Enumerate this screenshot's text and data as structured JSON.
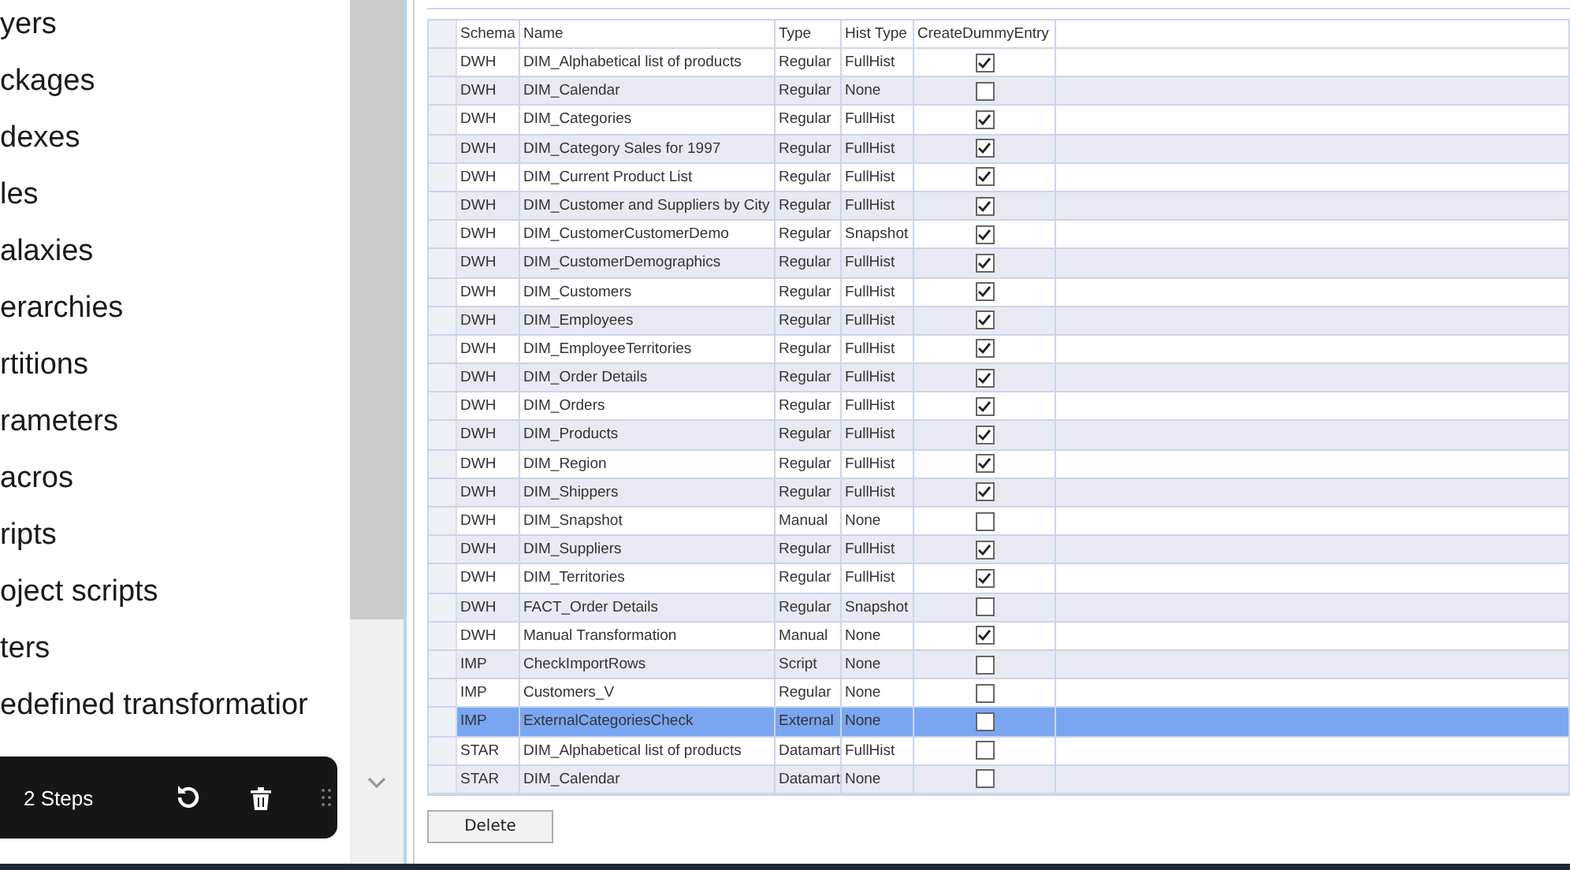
{
  "sidebar": {
    "items": [
      {
        "label": "yers"
      },
      {
        "label": "ckages"
      },
      {
        "label": "dexes"
      },
      {
        "label": "les"
      },
      {
        "label": "alaxies"
      },
      {
        "label": "erarchies"
      },
      {
        "label": "rtitions"
      },
      {
        "label": "rameters"
      },
      {
        "label": "acros"
      },
      {
        "label": "ripts"
      },
      {
        "label": "oject scripts"
      },
      {
        "label": "ters"
      },
      {
        "label": "edefined transformatior"
      }
    ]
  },
  "steps_toolbar": {
    "label": "2 Steps"
  },
  "table": {
    "columns": [
      "Schema",
      "Name",
      "Type",
      "Hist Type",
      "CreateDummyEntry"
    ],
    "rows": [
      {
        "schema": "DWH",
        "name": "DIM_Alphabetical list of products",
        "type": "Regular",
        "hist_type": "FullHist",
        "create_dummy_entry": true,
        "selected": false
      },
      {
        "schema": "DWH",
        "name": "DIM_Calendar",
        "type": "Regular",
        "hist_type": "None",
        "create_dummy_entry": false,
        "selected": false
      },
      {
        "schema": "DWH",
        "name": "DIM_Categories",
        "type": "Regular",
        "hist_type": "FullHist",
        "create_dummy_entry": true,
        "selected": false
      },
      {
        "schema": "DWH",
        "name": "DIM_Category Sales for 1997",
        "type": "Regular",
        "hist_type": "FullHist",
        "create_dummy_entry": true,
        "selected": false
      },
      {
        "schema": "DWH",
        "name": "DIM_Current Product List",
        "type": "Regular",
        "hist_type": "FullHist",
        "create_dummy_entry": true,
        "selected": false
      },
      {
        "schema": "DWH",
        "name": "DIM_Customer and Suppliers by City",
        "type": "Regular",
        "hist_type": "FullHist",
        "create_dummy_entry": true,
        "selected": false
      },
      {
        "schema": "DWH",
        "name": "DIM_CustomerCustomerDemo",
        "type": "Regular",
        "hist_type": "Snapshot",
        "create_dummy_entry": true,
        "selected": false
      },
      {
        "schema": "DWH",
        "name": "DIM_CustomerDemographics",
        "type": "Regular",
        "hist_type": "FullHist",
        "create_dummy_entry": true,
        "selected": false
      },
      {
        "schema": "DWH",
        "name": "DIM_Customers",
        "type": "Regular",
        "hist_type": "FullHist",
        "create_dummy_entry": true,
        "selected": false
      },
      {
        "schema": "DWH",
        "name": "DIM_Employees",
        "type": "Regular",
        "hist_type": "FullHist",
        "create_dummy_entry": true,
        "selected": false
      },
      {
        "schema": "DWH",
        "name": "DIM_EmployeeTerritories",
        "type": "Regular",
        "hist_type": "FullHist",
        "create_dummy_entry": true,
        "selected": false
      },
      {
        "schema": "DWH",
        "name": "DIM_Order Details",
        "type": "Regular",
        "hist_type": "FullHist",
        "create_dummy_entry": true,
        "selected": false
      },
      {
        "schema": "DWH",
        "name": "DIM_Orders",
        "type": "Regular",
        "hist_type": "FullHist",
        "create_dummy_entry": true,
        "selected": false
      },
      {
        "schema": "DWH",
        "name": "DIM_Products",
        "type": "Regular",
        "hist_type": "FullHist",
        "create_dummy_entry": true,
        "selected": false
      },
      {
        "schema": "DWH",
        "name": "DIM_Region",
        "type": "Regular",
        "hist_type": "FullHist",
        "create_dummy_entry": true,
        "selected": false
      },
      {
        "schema": "DWH",
        "name": "DIM_Shippers",
        "type": "Regular",
        "hist_type": "FullHist",
        "create_dummy_entry": true,
        "selected": false
      },
      {
        "schema": "DWH",
        "name": "DIM_Snapshot",
        "type": "Manual",
        "hist_type": "None",
        "create_dummy_entry": false,
        "selected": false
      },
      {
        "schema": "DWH",
        "name": "DIM_Suppliers",
        "type": "Regular",
        "hist_type": "FullHist",
        "create_dummy_entry": true,
        "selected": false
      },
      {
        "schema": "DWH",
        "name": "DIM_Territories",
        "type": "Regular",
        "hist_type": "FullHist",
        "create_dummy_entry": true,
        "selected": false
      },
      {
        "schema": "DWH",
        "name": "FACT_Order Details",
        "type": "Regular",
        "hist_type": "Snapshot",
        "create_dummy_entry": false,
        "selected": false
      },
      {
        "schema": "DWH",
        "name": "Manual Transformation",
        "type": "Manual",
        "hist_type": "None",
        "create_dummy_entry": true,
        "selected": false
      },
      {
        "schema": "IMP",
        "name": "CheckImportRows",
        "type": "Script",
        "hist_type": "None",
        "create_dummy_entry": false,
        "selected": false
      },
      {
        "schema": "IMP",
        "name": "Customers_V",
        "type": "Regular",
        "hist_type": "None",
        "create_dummy_entry": false,
        "selected": false
      },
      {
        "schema": "IMP",
        "name": "ExternalCategoriesCheck",
        "type": "External",
        "hist_type": "None",
        "create_dummy_entry": false,
        "selected": true
      },
      {
        "schema": "STAR",
        "name": "DIM_Alphabetical list of products",
        "type": "Datamart",
        "hist_type": "FullHist",
        "create_dummy_entry": false,
        "selected": false
      },
      {
        "schema": "STAR",
        "name": "DIM_Calendar",
        "type": "Datamart",
        "hist_type": "None",
        "create_dummy_entry": false,
        "selected": false
      }
    ]
  },
  "buttons": [
    "Delete"
  ]
}
